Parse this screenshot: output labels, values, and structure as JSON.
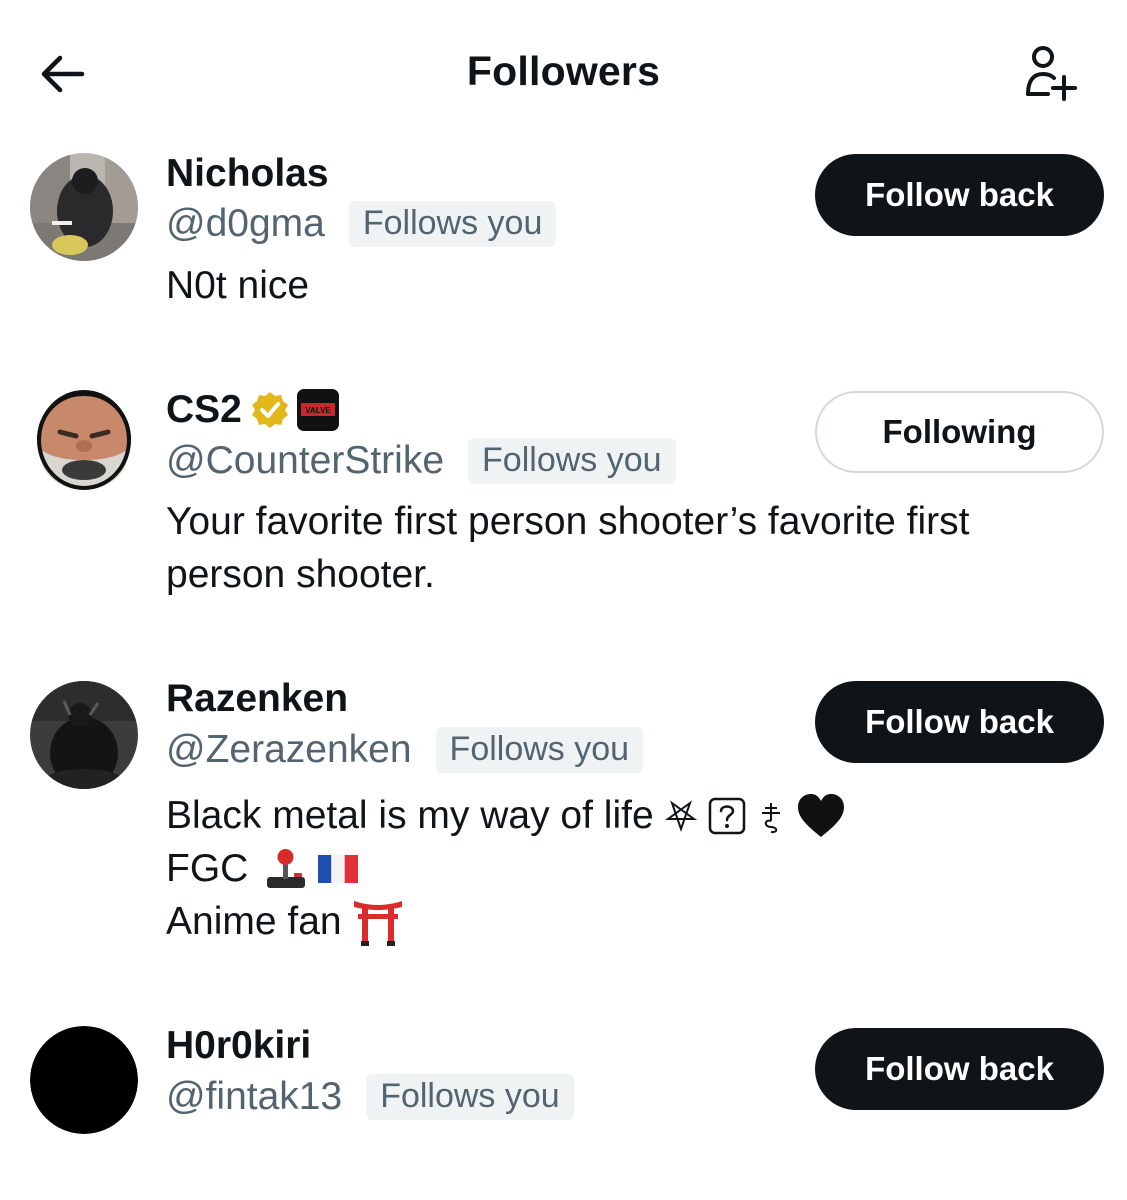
{
  "header": {
    "title": "Followers",
    "back_icon": "arrow-left-icon",
    "add_icon": "person-add-icon"
  },
  "followers": [
    {
      "name": "Nicholas",
      "handle": "@d0gma",
      "badge": "Follows you",
      "bio": [
        "N0t nice"
      ],
      "button": "Follow back"
    },
    {
      "name": "CS2",
      "handle": "@CounterStrike",
      "badge": "Follows you",
      "bio": [
        "Your favorite first person shooter’s favorite first",
        "person shooter."
      ],
      "button": "Following",
      "verified_badge_color": "#e2b719",
      "affiliate_label": "VALVE"
    },
    {
      "name": "Razenken",
      "handle": "@Zerazenken",
      "badge": "Follows you",
      "bio": [
        "Black metal is my way of life",
        "FGC",
        "Anime fan"
      ],
      "bio_icons": [
        "pentagram-icon",
        "question-box-icon",
        "leviathan-cross-icon",
        "black-heart-icon",
        "joystick-icon",
        "french-flag-icon",
        "torii-gate-icon"
      ],
      "button": "Follow back"
    },
    {
      "name": "H0r0kiri",
      "handle": "@fintak13",
      "badge": "Follows you",
      "bio": [],
      "button": "Follow back"
    }
  ],
  "colors": {
    "text_primary": "#0f1419",
    "text_secondary": "#536471",
    "badge_bg": "#eff3f4",
    "button_dark": "#0f1419",
    "button_border": "#cfd9de"
  }
}
